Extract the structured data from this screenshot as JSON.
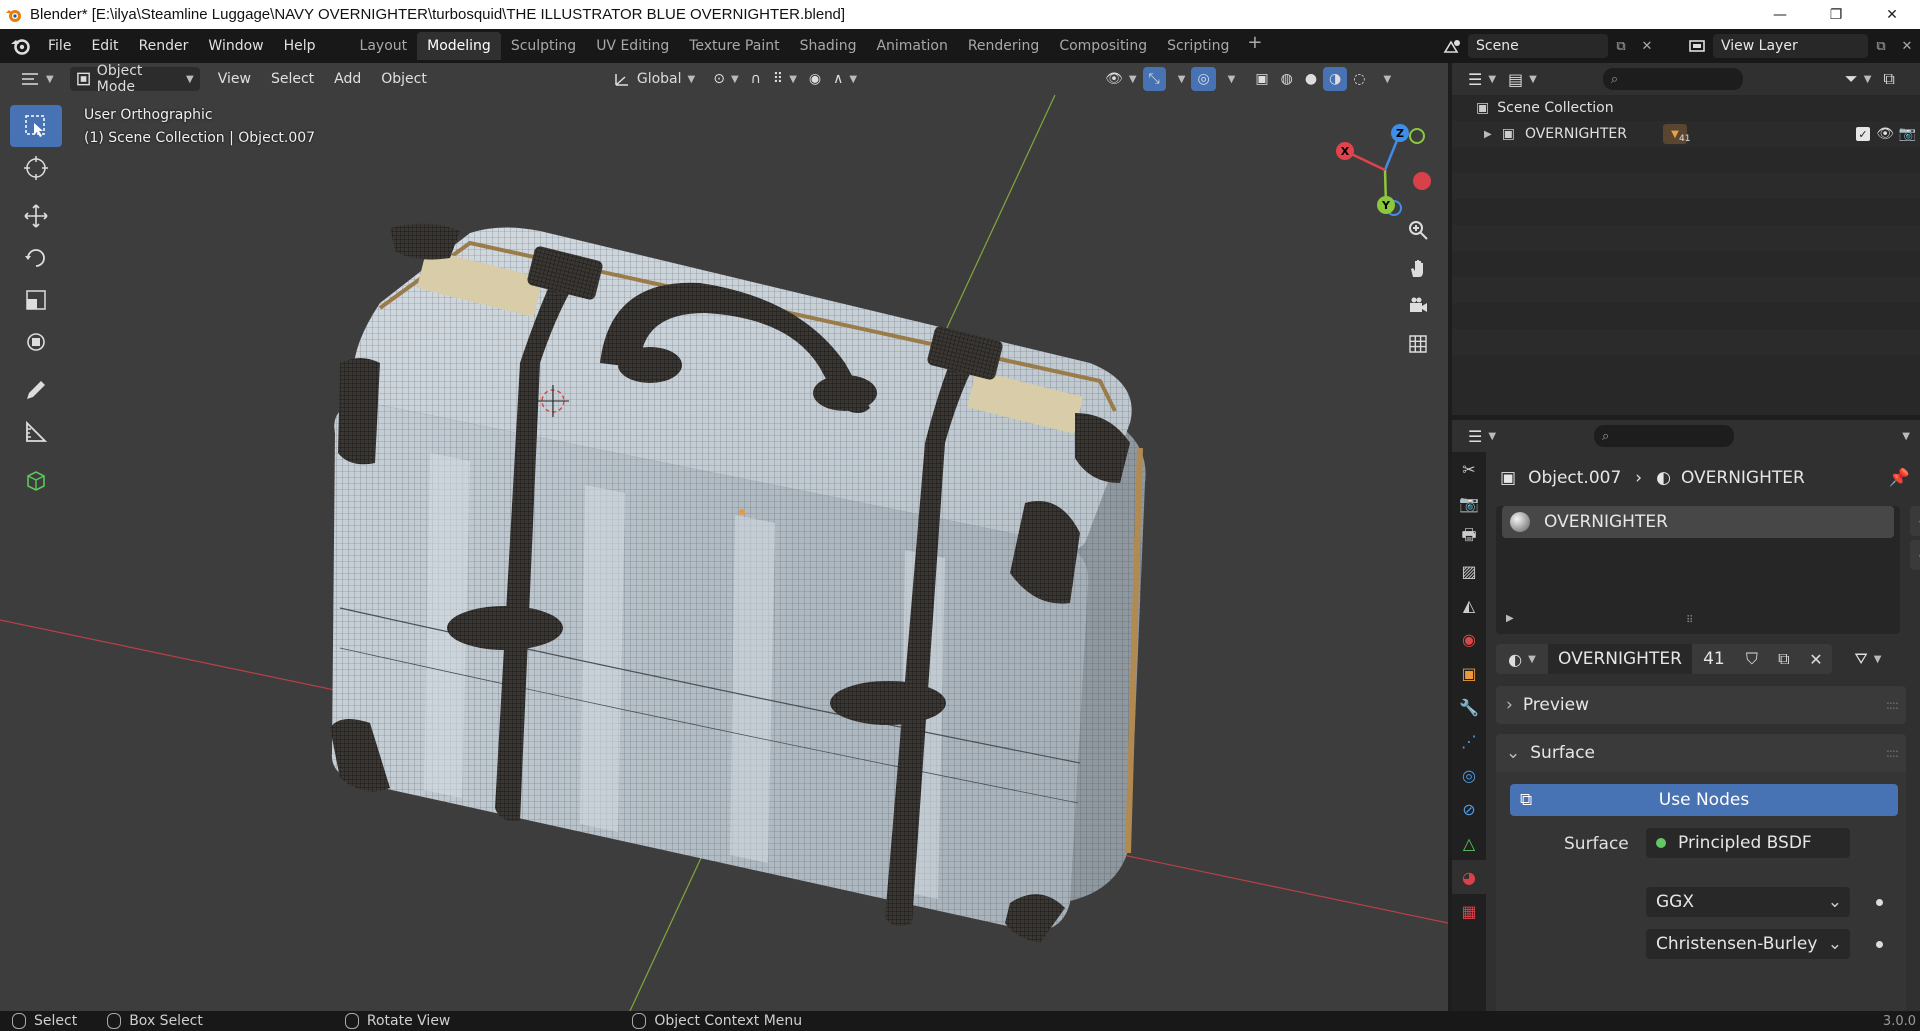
{
  "window": {
    "title": "Blender* [E:\\ilya\\Steamline Luggage\\NAVY OVERNIGHTER\\turbosquid\\THE ILLUSTRATOR BLUE OVERNIGHTER.blend]",
    "minimize": "—",
    "maximize": "❐",
    "close": "✕"
  },
  "menu": [
    "File",
    "Edit",
    "Render",
    "Window",
    "Help"
  ],
  "workspaces": [
    "Layout",
    "Modeling",
    "Sculpting",
    "UV Editing",
    "Texture Paint",
    "Shading",
    "Animation",
    "Rendering",
    "Compositing",
    "Scripting"
  ],
  "active_workspace": "Modeling",
  "scene_name": "Scene",
  "view_layer": "View Layer",
  "viewport": {
    "mode": "Object Mode",
    "menus": [
      "View",
      "Select",
      "Add",
      "Object"
    ],
    "orientation": "Global",
    "view_name": "User Orthographic",
    "collection_info": "(1) Scene Collection | Object.007",
    "gizmo_axes": {
      "x": "X",
      "y": "Y",
      "z": "Z"
    }
  },
  "outliner": {
    "root": "Scene Collection",
    "collection": "OVERNIGHTER",
    "child_count": "41"
  },
  "properties": {
    "object_name": "Object.007",
    "material_name": "OVERNIGHTER",
    "material_users": "41",
    "panels": {
      "preview": "Preview",
      "surface": "Surface"
    },
    "use_nodes": "Use Nodes",
    "surface_label": "Surface",
    "surface_value": "Principled BSDF",
    "distribution": "GGX",
    "subsurface_method": "Christensen-Burley"
  },
  "status": {
    "select": "Select",
    "box_select": "Box Select",
    "rotate": "Rotate View",
    "context_menu": "Object Context Menu",
    "version": "3.0.0"
  },
  "colors": {
    "accent": "#4772b3",
    "x_axis": "#e0434b",
    "y_axis": "#8cc83c",
    "z_axis": "#3f8ee8",
    "suitcase": "#b9c3cb"
  }
}
